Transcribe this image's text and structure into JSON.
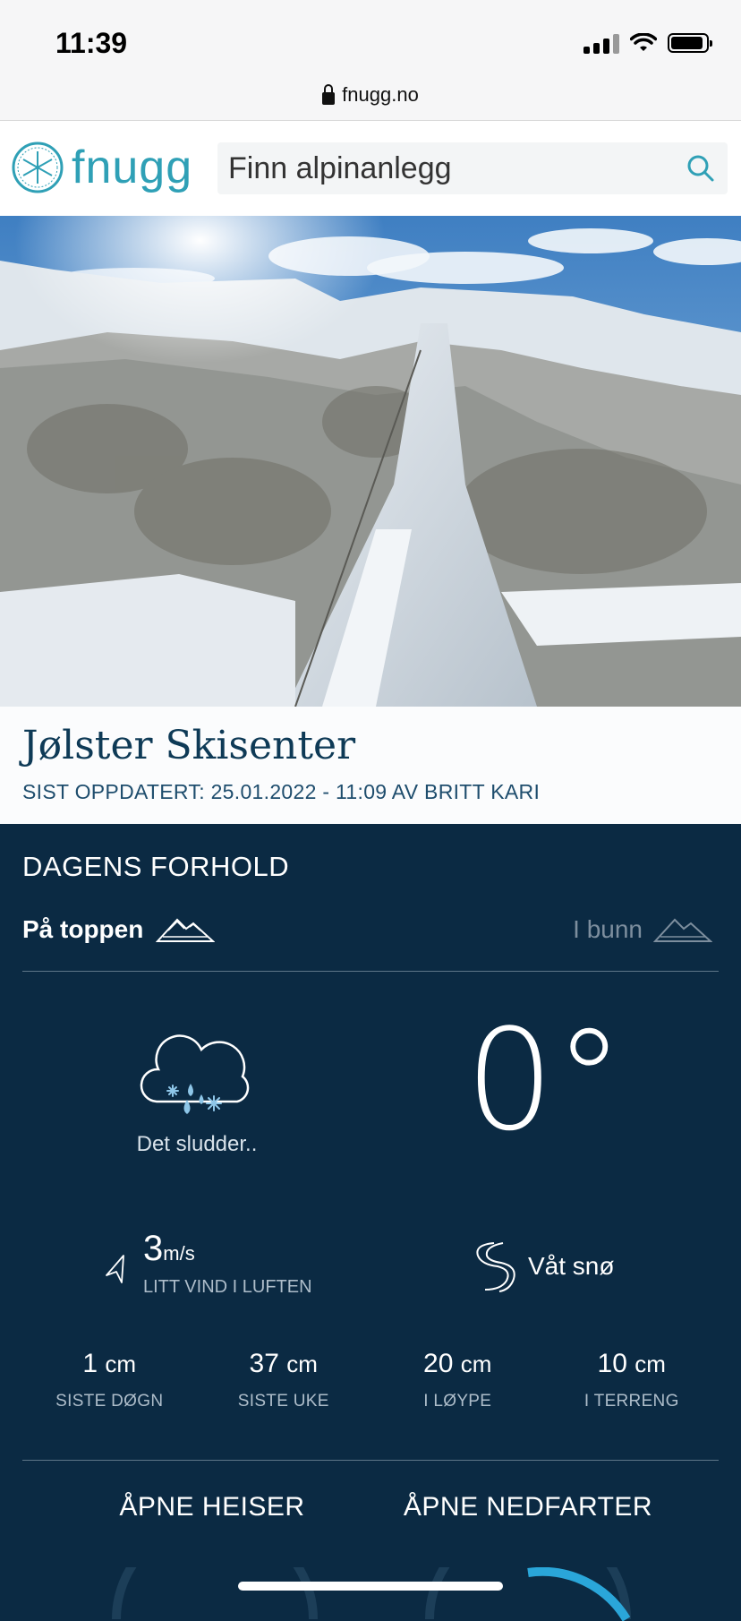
{
  "status_bar": {
    "time": "11:39"
  },
  "browser": {
    "url": "fnugg.no"
  },
  "header": {
    "logo_text": "fnugg",
    "search_placeholder": "Finn alpinanlegg"
  },
  "resort": {
    "name": "Jølster Skisenter",
    "updated": "SIST OPPDATERT: 25.01.2022 - 11:09 AV BRITT KARI"
  },
  "conditions": {
    "heading": "DAGENS FORHOLD",
    "tabs": {
      "top": "På toppen",
      "bottom": "I bunn",
      "active": "top"
    },
    "weather_description": "Det sludder..",
    "temperature": "0°",
    "wind": {
      "value": "3",
      "unit": "m/s",
      "label": "LITT VIND I LUFTEN"
    },
    "snow_type": "Våt snø",
    "stats": [
      {
        "value": "1",
        "unit": "cm",
        "label": "SISTE DØGN"
      },
      {
        "value": "37",
        "unit": "cm",
        "label": "SISTE UKE"
      },
      {
        "value": "20",
        "unit": "cm",
        "label": "I LØYPE"
      },
      {
        "value": "10",
        "unit": "cm",
        "label": "I TERRENG"
      }
    ],
    "open_lifts_label": "ÅPNE HEISER",
    "open_runs_label": "ÅPNE NEDFARTER"
  },
  "icons": {
    "logo": "snowflake-icon",
    "search": "search-icon",
    "weather": "sleet-cloud-icon",
    "wind": "wind-arrow-icon",
    "snow": "ski-trail-icon",
    "mountain": "mountain-icon"
  },
  "colors": {
    "brand": "#2fa0b6",
    "dark_bg": "#0b2a43",
    "title": "#0e3a56"
  }
}
